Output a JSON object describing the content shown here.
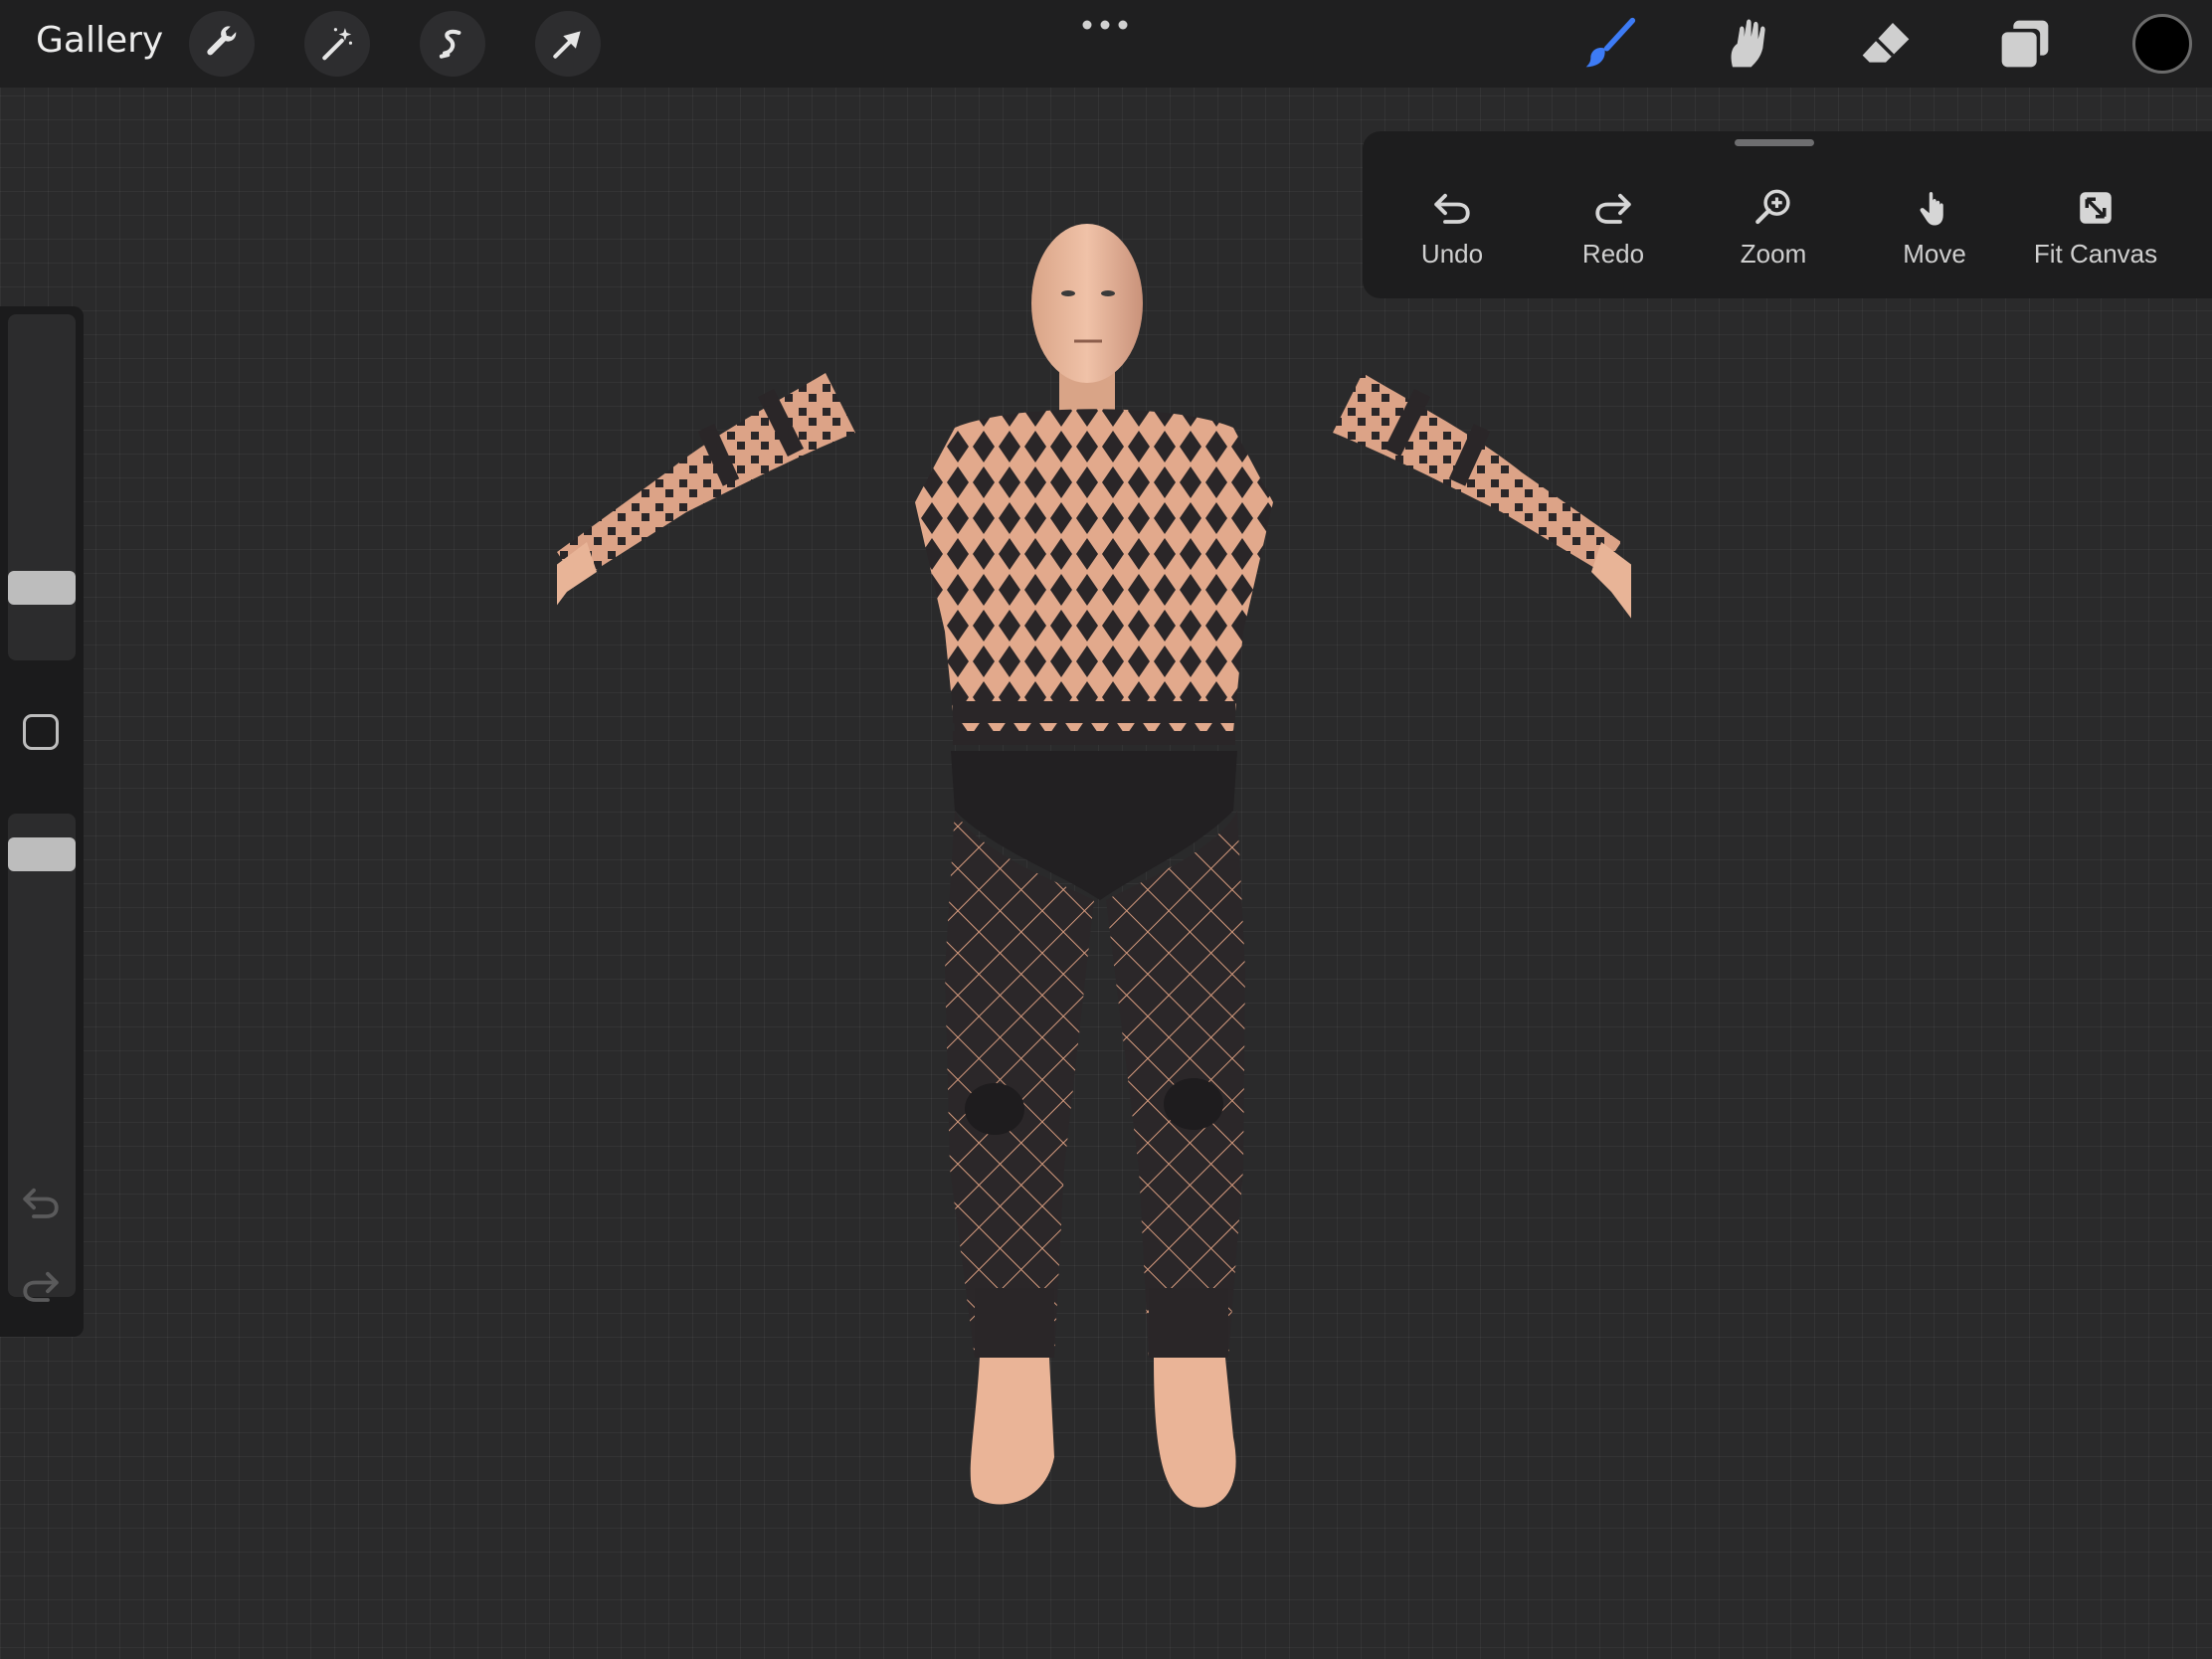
{
  "topbar": {
    "gallery_label": "Gallery",
    "left_tools": [
      "wrench-icon",
      "magic-wand-icon",
      "selection-icon",
      "move-arrow-icon"
    ],
    "more_icon": "ellipsis-icon",
    "right_tools": [
      "brush-icon",
      "smudge-icon",
      "eraser-icon",
      "layers-icon"
    ],
    "active_tool": "brush",
    "accent_color": "#3d7bf5",
    "current_color": "#000000"
  },
  "quick_menu": {
    "items": [
      {
        "label": "Undo",
        "icon": "undo-icon"
      },
      {
        "label": "Redo",
        "icon": "redo-icon"
      },
      {
        "label": "Zoom",
        "icon": "zoom-icon"
      },
      {
        "label": "Move",
        "icon": "hand-icon"
      },
      {
        "label": "Fit Canvas",
        "icon": "fit-canvas-icon"
      }
    ]
  },
  "sidebar": {
    "brush_size_level": 0.17,
    "opacity_level": 0.04,
    "modify_icon": "square-icon",
    "undo_icon": "undo-icon",
    "redo_icon": "redo-icon"
  },
  "canvas": {
    "subject": "3d-figure-tattoo-model"
  }
}
